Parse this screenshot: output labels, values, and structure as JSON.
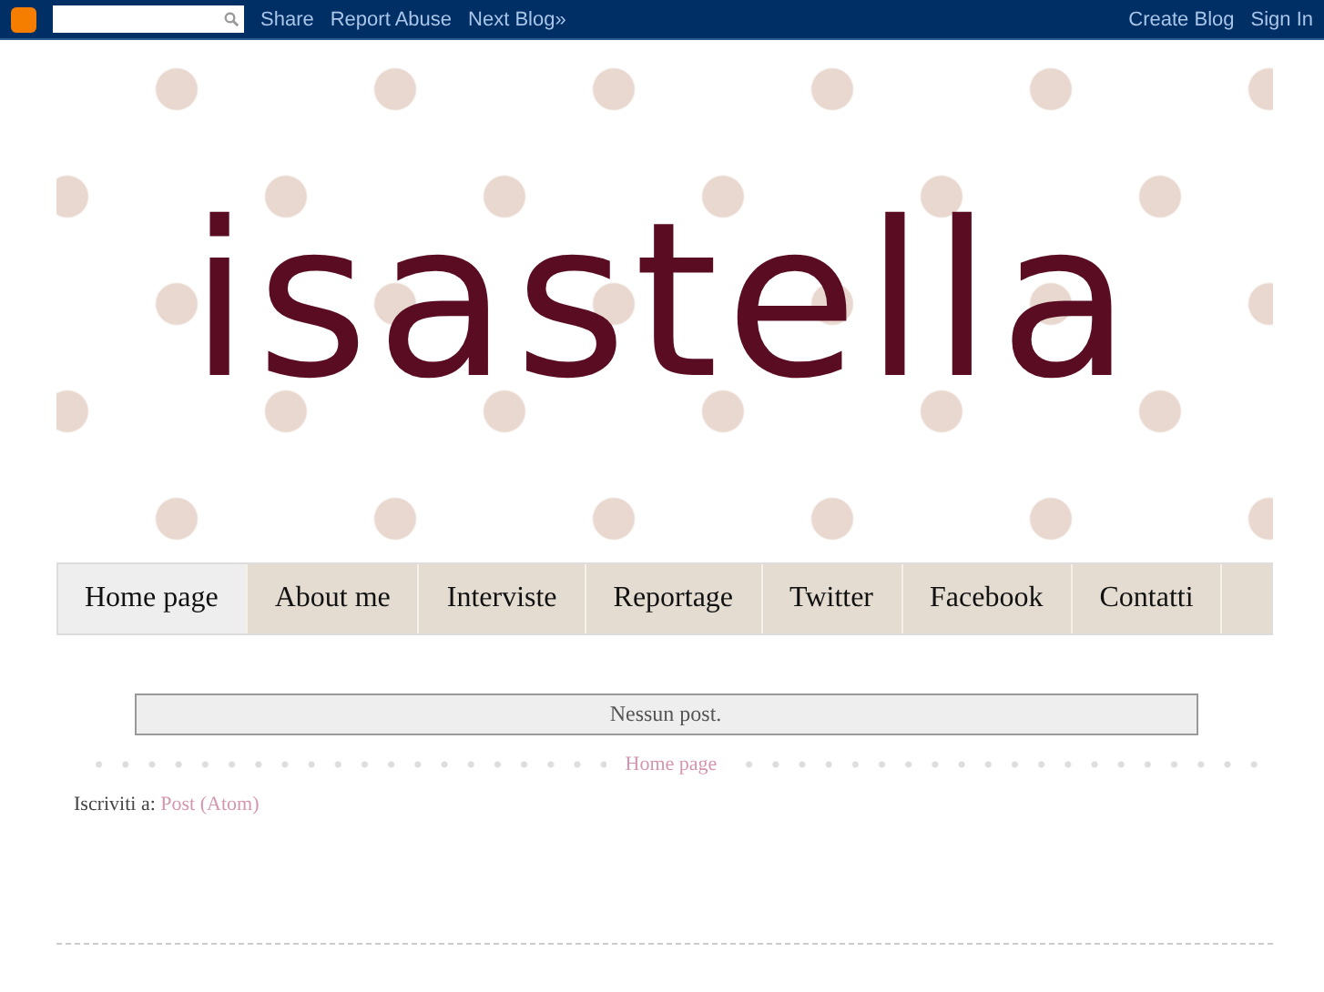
{
  "navbar": {
    "links": [
      "Share",
      "Report Abuse",
      "Next Blog»"
    ],
    "right_links": [
      "Create Blog",
      "Sign In"
    ]
  },
  "header": {
    "title": "isastella"
  },
  "tabs": [
    {
      "label": "Home page",
      "selected": true
    },
    {
      "label": "About me",
      "selected": false
    },
    {
      "label": "Interviste",
      "selected": false
    },
    {
      "label": "Reportage",
      "selected": false
    },
    {
      "label": "Twitter",
      "selected": false
    },
    {
      "label": "Facebook",
      "selected": false
    },
    {
      "label": "Contatti",
      "selected": false
    }
  ],
  "status_message": "Nessun post.",
  "pager": {
    "home_link": "Home page"
  },
  "feed": {
    "label": "Iscriviti a:",
    "link": "Post (Atom)"
  }
}
